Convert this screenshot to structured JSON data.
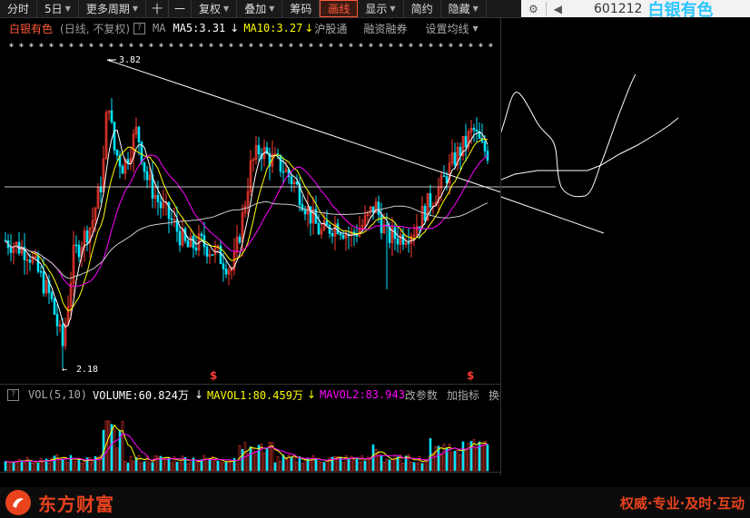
{
  "toolbar": {
    "items": [
      "分时",
      "5日",
      "更多周期",
      "十",
      "一",
      "复权",
      "叠加",
      "筹码",
      "画线",
      "显示",
      "简约",
      "隐藏"
    ],
    "active": "画线"
  },
  "stock": {
    "code": "601212",
    "name": "白银有色"
  },
  "main_panel": {
    "name": "白银有色",
    "period_label": "(日线, 不复权)",
    "indicator_name": "MA",
    "ma5": "MA5:3.31",
    "ma10": "MA10:3.27",
    "links": [
      "沪股通",
      "融资融券",
      "设置均线"
    ]
  },
  "annotations": {
    "high": "3.82",
    "low": "2.18",
    "s_marker": "$"
  },
  "volume_panel": {
    "indicator": "VOL(5,10)",
    "volume": "VOLUME:60.824万",
    "mavol1": "MAVOL1:80.459万",
    "mavol2": "MAVOL2:83.943",
    "buttons": [
      "改参数",
      "加指标",
      "换指标"
    ]
  },
  "footer": {
    "brand": "东方财富",
    "slogan": "权威·专业·及时·互动"
  },
  "colors": {
    "up": "#ff3b30",
    "down": "#00e5ff",
    "ma5": "#ffffff",
    "ma10": "#ffff00",
    "ma20": "#ff00ff",
    "accent": "#e8431d"
  }
}
